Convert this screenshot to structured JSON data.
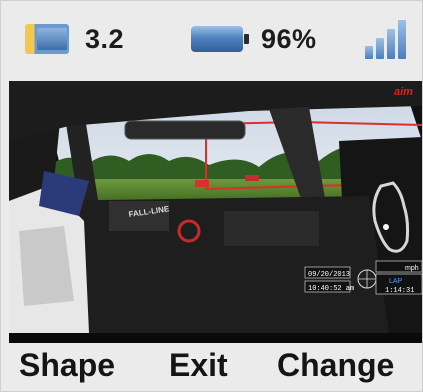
{
  "status": {
    "monitor_value": "3.2",
    "battery_value": "96%"
  },
  "video": {
    "overlay_brand": "aim",
    "car_decal": "FALL-LINE",
    "date": "09/20/2013",
    "time": "10:40:52 am",
    "speed_unit": "mph",
    "lap_label": "LAP",
    "lap_time": "1:14:31"
  },
  "menu": {
    "shape_label": "Shape",
    "exit_label": "Exit",
    "change_label": "Change"
  }
}
